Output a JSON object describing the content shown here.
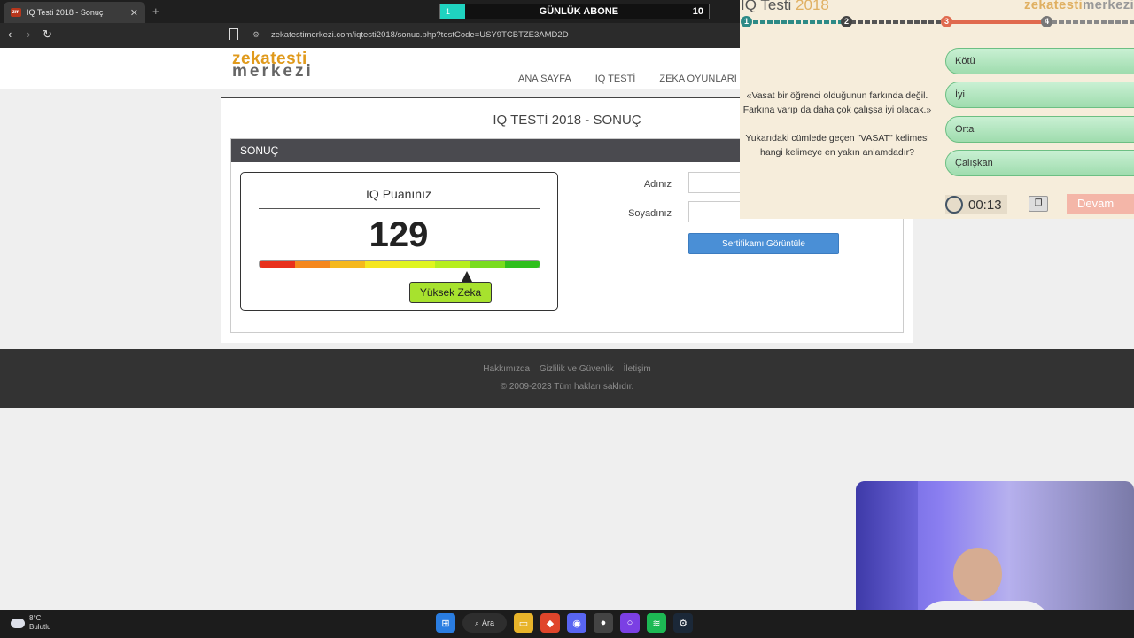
{
  "browser": {
    "tab_title": "IQ Testi 2018 - Sonuç",
    "tab_favicon": "zm",
    "url": "zekatestimerkezi.com/iqtesti2018/sonuc.php?testCode=USY9TCBTZE3AMD2D"
  },
  "stream_widget": {
    "progress_value": "1",
    "label": "GÜNLÜK ABONE",
    "count": "10"
  },
  "site": {
    "logo_top": "zekatesti",
    "logo_bottom": "merkezi",
    "nav": [
      "ANA SAYFA",
      "IQ TESTİ",
      "ZEKA OYUNLARI"
    ]
  },
  "result": {
    "page_title": "IQ TESTİ 2018 - SONUÇ",
    "section_title": "SONUÇ",
    "iq_label": "IQ Puanınız",
    "iq_score": "129",
    "level_label": "Yüksek Zeka",
    "marker_fraction": 0.74,
    "scale_colors": [
      "#e8301c",
      "#f4871d",
      "#f5b81d",
      "#f5e61f",
      "#dff51f",
      "#b6ef1e",
      "#79dc1f",
      "#2fbf1d"
    ],
    "first_name_label": "Adınız",
    "last_name_label": "Soyadınız",
    "first_name_value": "",
    "last_name_value": "",
    "certificate_button": "Sertifikamı Görüntüle"
  },
  "footer": {
    "links": [
      "Hakkımızda",
      "Gizlilik ve Güvenlik",
      "İletişim"
    ],
    "copyright": "© 2009-2023 Tüm hakları saklıdır."
  },
  "quiz": {
    "title_text": "IQ Testi ",
    "title_year": "2018",
    "brand_a": "zekatesti",
    "brand_b": "merkezi",
    "steps": [
      "1",
      "2",
      "3",
      "4"
    ],
    "question_quote_1": "«Vasat bir öğrenci olduğunun farkında değil.",
    "question_quote_2": "Farkına varıp da daha çok çalışsa iyi olacak.»",
    "question_prompt_1": "Yukarıdaki cümlede geçen \"VASAT\" kelimesi",
    "question_prompt_2": "hangi kelimeye en yakın anlamdadır?",
    "options": [
      "Kötü",
      "İyi",
      "Orta",
      "Çalışkan"
    ],
    "timer": "00:13",
    "next_button": "Devam"
  },
  "taskbar": {
    "weather_temp": "8°C",
    "weather_desc": "Bulutlu",
    "search_label": "Ara"
  }
}
